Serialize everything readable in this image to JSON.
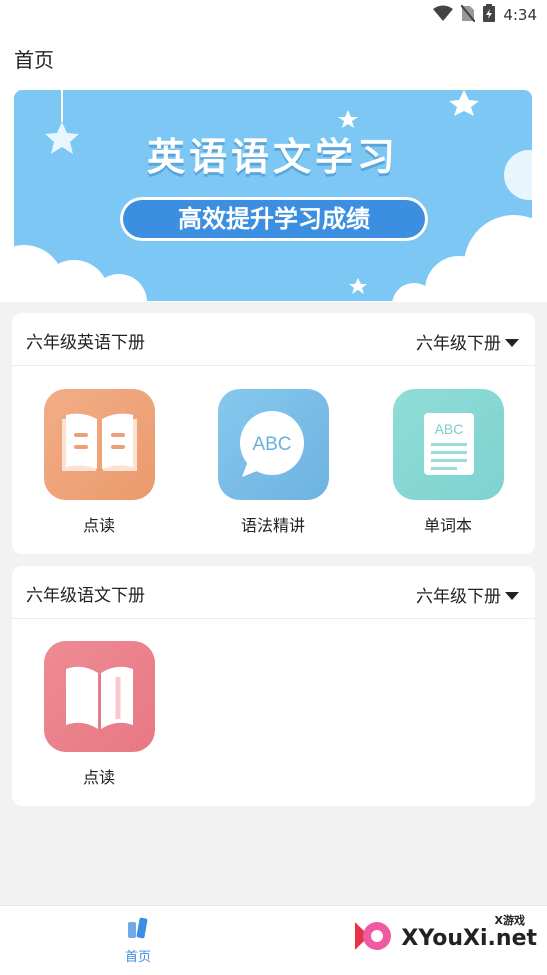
{
  "status_bar": {
    "time": "4:34",
    "icons": [
      "wifi-icon",
      "no-sim-icon",
      "battery-icon"
    ]
  },
  "header": {
    "title": "首页"
  },
  "banner": {
    "title": "英语语文学习",
    "subtitle": "高效提升学习成绩"
  },
  "sections": [
    {
      "title": "六年级英语下册",
      "grade_select": "六年级下册",
      "items": [
        {
          "label": "点读",
          "icon": "open-book-icon",
          "color": "#f0a57c"
        },
        {
          "label": "语法精讲",
          "icon": "abc-chat-bubble-icon",
          "color": "#7dc0e8"
        },
        {
          "label": "单词本",
          "icon": "word-list-icon",
          "color": "#86d9d4"
        }
      ]
    },
    {
      "title": "六年级语文下册",
      "grade_select": "六年级下册",
      "items": [
        {
          "label": "点读",
          "icon": "book-icon",
          "color": "#ea7f88"
        }
      ]
    }
  ],
  "tabbar": {
    "home_label": "首页",
    "home_icon": "books-icon",
    "accent": "#3a8ee6"
  },
  "watermark": {
    "text": "XYouXi.net",
    "small": "X游戏"
  }
}
